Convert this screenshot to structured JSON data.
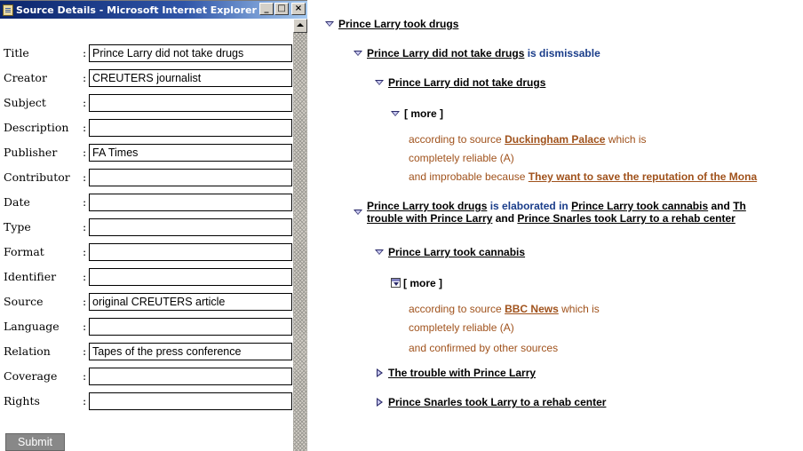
{
  "window": {
    "title": "Source Details - Microsoft Internet Explorer",
    "buttons": {
      "minimize": "_",
      "maximize": "□",
      "close": "×"
    }
  },
  "form": {
    "fields": [
      {
        "label": "Title",
        "value": "Prince Larry did not take drugs"
      },
      {
        "label": "Creator",
        "value": "CREUTERS journalist"
      },
      {
        "label": "Subject",
        "value": ""
      },
      {
        "label": "Description",
        "value": ""
      },
      {
        "label": "Publisher",
        "value": "FA Times"
      },
      {
        "label": "Contributor",
        "value": ""
      },
      {
        "label": "Date",
        "value": ""
      },
      {
        "label": "Type",
        "value": ""
      },
      {
        "label": "Format",
        "value": ""
      },
      {
        "label": "Identifier",
        "value": ""
      },
      {
        "label": "Source",
        "value": "original CREUTERS article"
      },
      {
        "label": "Language",
        "value": ""
      },
      {
        "label": "Relation",
        "value": "Tapes of the press conference"
      },
      {
        "label": "Coverage",
        "value": ""
      },
      {
        "label": "Rights",
        "value": ""
      }
    ],
    "colon": ":",
    "submit_label": "Submit"
  },
  "tree": {
    "root": "Prince Larry took drugs",
    "n1": {
      "subject": "Prince Larry did not take drugs",
      "relation": "is dismissable"
    },
    "n1a": "Prince Larry did not take drugs",
    "more1": "[ more ]",
    "d1": {
      "line1_pre": "according to source",
      "line1_link": "Duckingham Palace",
      "line1_post": "which is",
      "line2": "completely reliable (A)",
      "line3_pre": "and improbable because",
      "line3_link": "They want to save the reputation of the Mona"
    },
    "n2": {
      "subject": "Prince Larry took drugs",
      "relation": "is elaborated in",
      "link1": "Prince Larry took cannabis",
      "and1": "and",
      "link2a": "Th",
      "link2b": "trouble with Prince Larry",
      "and2": "and",
      "link3": "Prince Snarles took Larry to a rehab center"
    },
    "n2a": "Prince Larry took cannabis",
    "more2": "[ more ]",
    "d2": {
      "line1_pre": "according to source",
      "line1_link": "BBC News",
      "line1_post": "which is",
      "line2": "completely reliable (A)",
      "line3": "and confirmed by other sources"
    },
    "n2b": "The trouble with Prince Larry",
    "n2c": "Prince Snarles took Larry to a rehab center"
  }
}
